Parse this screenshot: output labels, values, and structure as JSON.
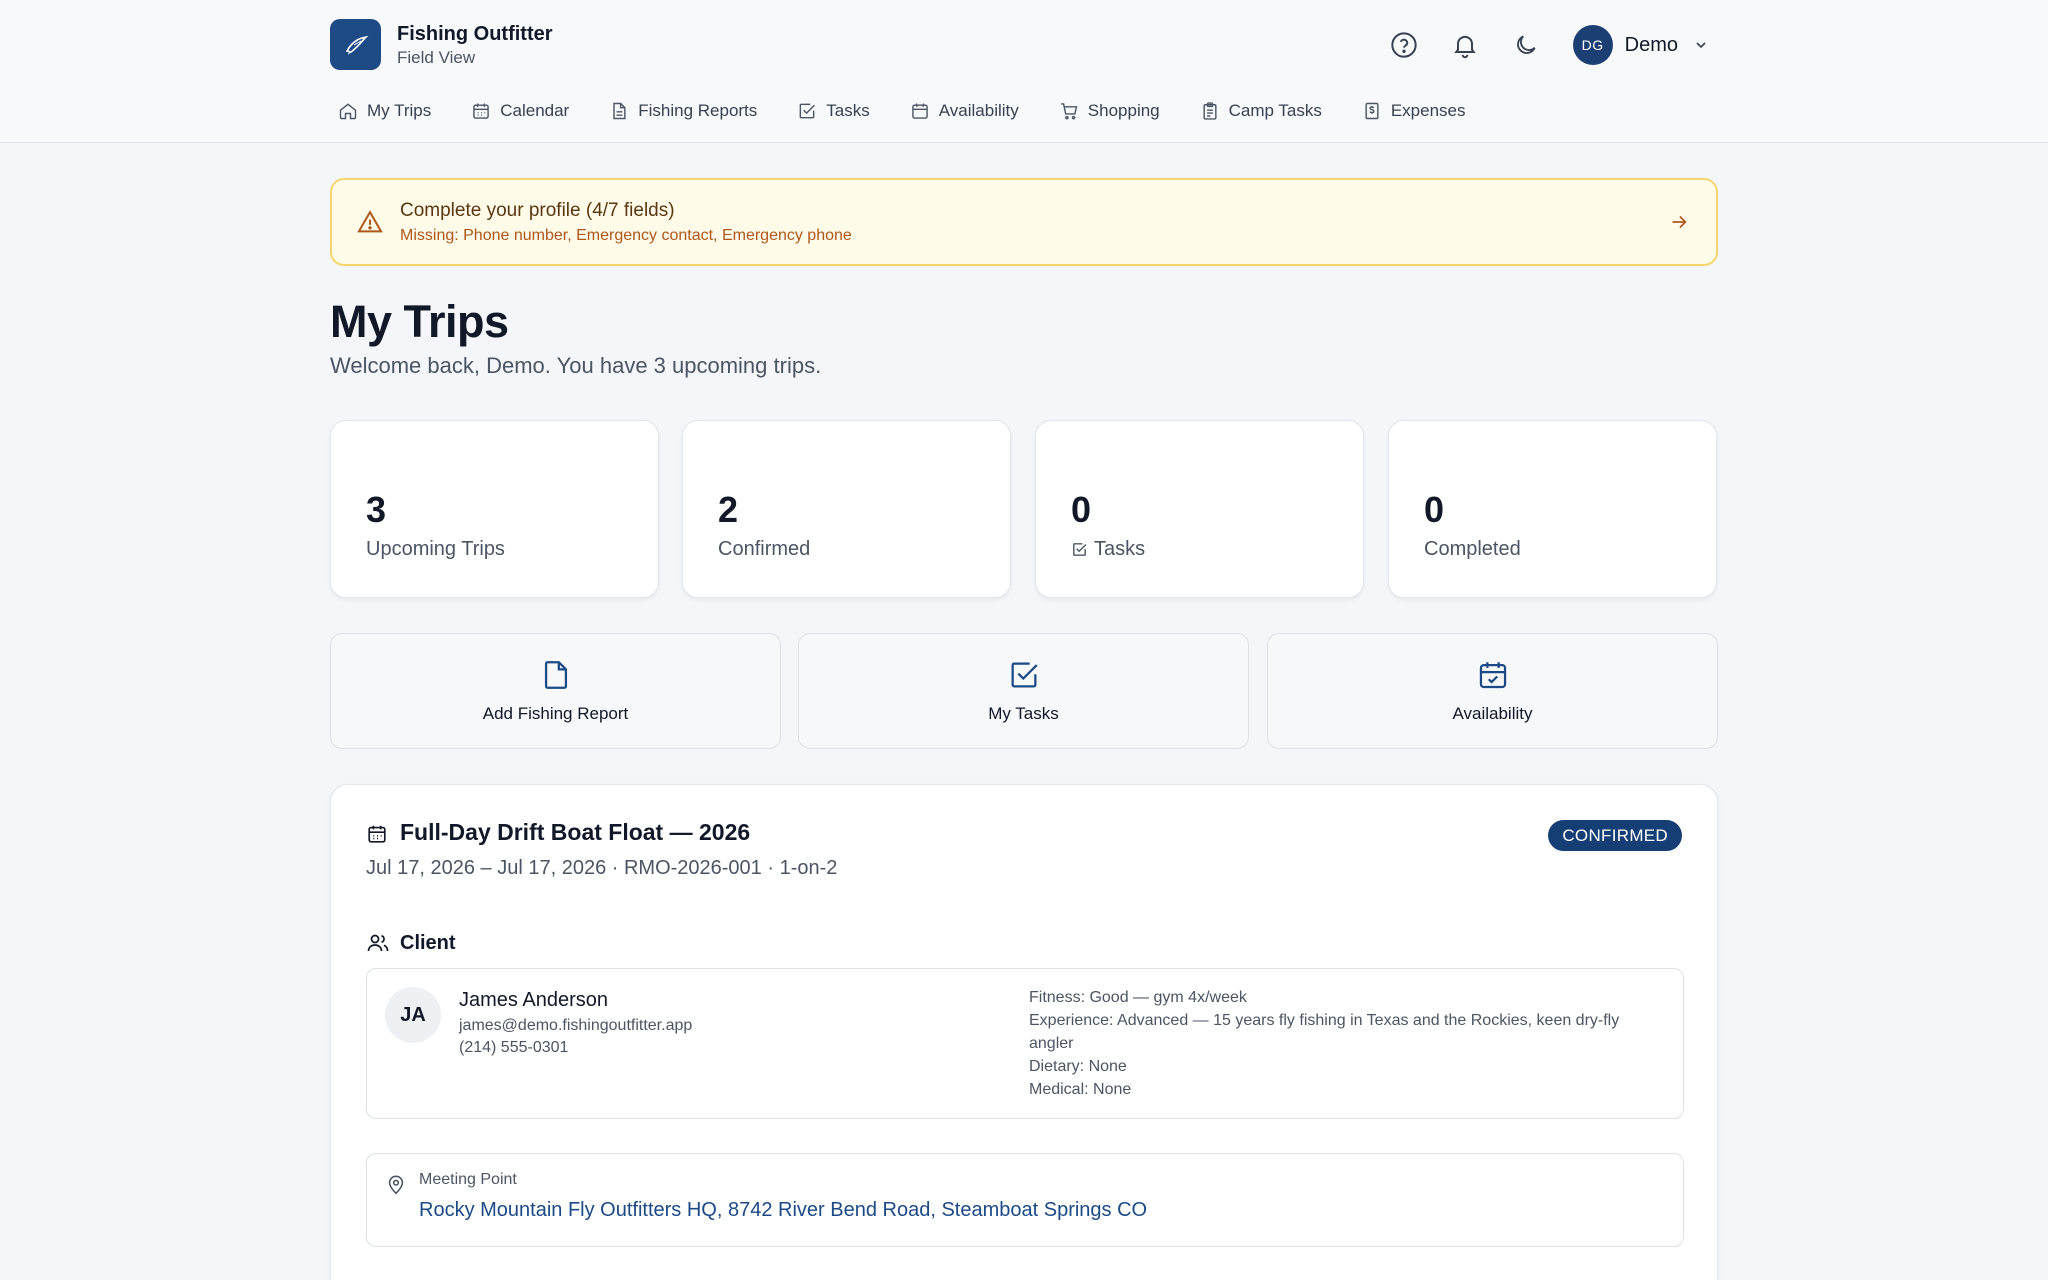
{
  "brand": {
    "name": "Fishing Outfitter",
    "subtitle": "Field View"
  },
  "user": {
    "initials": "DG",
    "name": "Demo"
  },
  "header_icons": [
    "help-icon",
    "bell-icon",
    "moon-icon"
  ],
  "nav": [
    {
      "label": "My Trips",
      "icon": "home-icon"
    },
    {
      "label": "Calendar",
      "icon": "calendar-icon"
    },
    {
      "label": "Fishing Reports",
      "icon": "document-icon"
    },
    {
      "label": "Tasks",
      "icon": "checkbox-icon"
    },
    {
      "label": "Availability",
      "icon": "calendar-icon"
    },
    {
      "label": "Shopping",
      "icon": "cart-icon"
    },
    {
      "label": "Camp Tasks",
      "icon": "clipboard-icon"
    },
    {
      "label": "Expenses",
      "icon": "receipt-icon"
    }
  ],
  "banner": {
    "title": "Complete your profile (4/7 fields)",
    "missing": "Missing: Phone number, Emergency contact, Emergency phone"
  },
  "page": {
    "title": "My Trips",
    "subtitle": "Welcome back, Demo. You have 3 upcoming trips."
  },
  "stats": [
    {
      "value": "3",
      "label": "Upcoming Trips"
    },
    {
      "value": "2",
      "label": "Confirmed"
    },
    {
      "value": "0",
      "label": "Tasks"
    },
    {
      "value": "0",
      "label": "Completed"
    }
  ],
  "actions": [
    {
      "label": "Add Fishing Report",
      "icon": "file-icon"
    },
    {
      "label": "My Tasks",
      "icon": "check-square-icon"
    },
    {
      "label": "Availability",
      "icon": "calendar-check-icon"
    }
  ],
  "trip": {
    "title": "Full-Day Drift Boat Float — 2026",
    "meta": "Jul 17, 2026 – Jul 17, 2026 · RMO-2026-001 · 1-on-2",
    "status": "CONFIRMED",
    "client_heading": "Client",
    "client": {
      "initials": "JA",
      "name": "James Anderson",
      "email": "james@demo.fishingoutfitter.app",
      "phone": "(214) 555-0301",
      "fitness": "Fitness: Good — gym 4x/week",
      "experience": "Experience: Advanced — 15 years fly fishing in Texas and the Rockies, keen dry-fly angler",
      "dietary": "Dietary: None",
      "medical": "Medical: None"
    },
    "meeting_label": "Meeting Point",
    "meeting_point": "Rocky Mountain Fly Outfitters HQ, 8742 River Bend Road, Steamboat Springs CO"
  },
  "colors": {
    "accent": "#153e74",
    "banner_bg": "#fefbe8",
    "banner_border": "#f4d56b",
    "warning_text": "#b0561d"
  }
}
